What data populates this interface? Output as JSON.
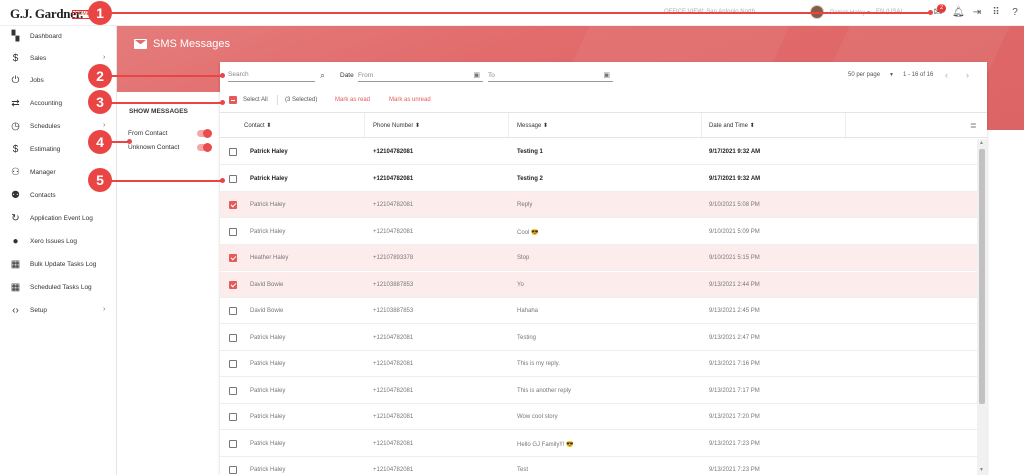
{
  "topbar": {
    "logo": "G.J. Gardner.",
    "logo_badge": "HOMES",
    "office": "OFFICE VIEW: San Antonio North",
    "user_name": "Patrick Haley",
    "language": "EN (USA)",
    "notification_count": "2"
  },
  "sidebar": {
    "items": [
      {
        "label": "Dashboard"
      },
      {
        "label": "Sales"
      },
      {
        "label": "Jobs"
      },
      {
        "label": "Accounting"
      },
      {
        "label": "Schedules"
      },
      {
        "label": "Estimating"
      },
      {
        "label": "Manager"
      },
      {
        "label": "Contacts"
      },
      {
        "label": "Application Event Log"
      },
      {
        "label": "Xero Issues Log"
      },
      {
        "label": "Bulk Update Tasks Log"
      },
      {
        "label": "Scheduled Tasks Log"
      },
      {
        "label": "Setup"
      }
    ]
  },
  "banner": {
    "title": "SMS Messages"
  },
  "filters": {
    "search_placeholder": "Search",
    "date_label": "Date",
    "from_placeholder": "From",
    "to_placeholder": "To",
    "per_page": "50 per page",
    "range": "1 - 16 of 16"
  },
  "actions": {
    "select_all": "Select All",
    "selected_count": "(3 Selected)",
    "mark_read": "Mark as read",
    "mark_unread": "Mark as unread"
  },
  "show_messages": {
    "title": "SHOW MESSAGES",
    "from_contact": "From Contact",
    "unknown_contact": "Unknown Contact"
  },
  "table": {
    "headers": {
      "contact": "Contact ⬍",
      "phone": "Phone Number ⬍",
      "message": "Message ⬍",
      "datetime": "Date and Time ⬍"
    },
    "rows": [
      {
        "contact": "Patrick Haley",
        "phone": "+12104782081",
        "message": "Testing 1",
        "datetime": "9/17/2021 9:32 AM",
        "unread": true,
        "checked": false
      },
      {
        "contact": "Patrick Haley",
        "phone": "+12104782081",
        "message": "Testing 2",
        "datetime": "9/17/2021 9:32 AM",
        "unread": true,
        "checked": false
      },
      {
        "contact": "Patrick Haley",
        "phone": "+12104782081",
        "message": "Reply",
        "datetime": "9/10/2021 5:08 PM",
        "unread": false,
        "checked": true
      },
      {
        "contact": "Patrick Haley",
        "phone": "+12104782081",
        "message": "Cool 😎",
        "datetime": "9/10/2021 5:09 PM",
        "unread": false,
        "checked": false
      },
      {
        "contact": "Heather Haley",
        "phone": "+12107893378",
        "message": "Stop",
        "datetime": "9/10/2021 5:15 PM",
        "unread": false,
        "checked": true
      },
      {
        "contact": "David Bowie",
        "phone": "+12103887853",
        "message": "Yo",
        "datetime": "9/13/2021 2:44 PM",
        "unread": false,
        "checked": true
      },
      {
        "contact": "David Bowie",
        "phone": "+12103887853",
        "message": "Hahaha",
        "datetime": "9/13/2021 2:45 PM",
        "unread": false,
        "checked": false
      },
      {
        "contact": "Patrick Haley",
        "phone": "+12104782081",
        "message": "Testing",
        "datetime": "9/13/2021 2:47 PM",
        "unread": false,
        "checked": false
      },
      {
        "contact": "Patrick Haley",
        "phone": "+12104782081",
        "message": "This is my reply.",
        "datetime": "9/13/2021 7:16 PM",
        "unread": false,
        "checked": false
      },
      {
        "contact": "Patrick Haley",
        "phone": "+12104782081",
        "message": "This is another reply",
        "datetime": "9/13/2021 7:17 PM",
        "unread": false,
        "checked": false
      },
      {
        "contact": "Patrick Haley",
        "phone": "+12104782081",
        "message": "Wow cool story",
        "datetime": "9/13/2021 7:20 PM",
        "unread": false,
        "checked": false
      },
      {
        "contact": "Patrick Haley",
        "phone": "+12104782081",
        "message": "Hello GJ Family!!! 😎",
        "datetime": "9/13/2021 7:23 PM",
        "unread": false,
        "checked": false
      },
      {
        "contact": "Patrick Haley",
        "phone": "+12104782081",
        "message": "Test",
        "datetime": "9/13/2021 7:23 PM",
        "unread": false,
        "checked": false
      }
    ]
  },
  "callouts": [
    "1",
    "2",
    "3",
    "4",
    "5"
  ],
  "colors": {
    "accent": "#e55a5a",
    "banner": "#e26b6b",
    "callout": "#e94545"
  }
}
